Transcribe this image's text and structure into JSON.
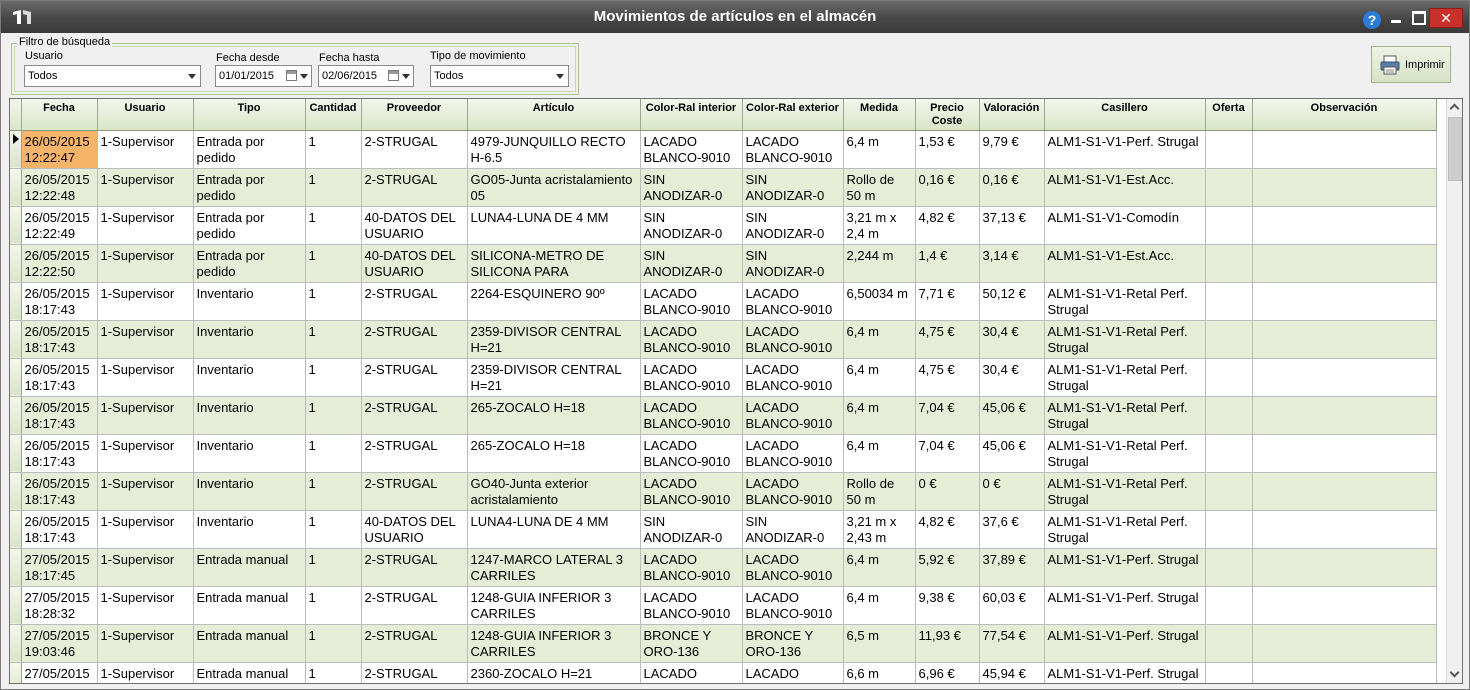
{
  "window": {
    "title": "Movimientos de artículos en el almacén",
    "help": "?",
    "close": "✕"
  },
  "filter": {
    "legend": "Filtro de búsqueda",
    "usuario": {
      "label": "Usuario",
      "value": "Todos"
    },
    "fecha_desde": {
      "label": "Fecha desde",
      "value": "01/01/2015"
    },
    "fecha_hasta": {
      "label": "Fecha hasta",
      "value": "02/06/2015"
    },
    "tipo": {
      "label": "Tipo de movimiento",
      "value": "Todos"
    }
  },
  "print_button": {
    "label": "Imprimir"
  },
  "columns": [
    "Fecha",
    "Usuario",
    "Tipo",
    "Cantidad",
    "Proveedor",
    "Artículo",
    "Color-Ral interior",
    "Color-Ral exterior",
    "Medida",
    "Precio Coste",
    "Valoración",
    "Casillero",
    "Oferta",
    "Observación"
  ],
  "rows": [
    [
      "26/05/2015 12:22:47",
      "1-Supervisor",
      "Entrada por pedido",
      "1",
      "2-STRUGAL",
      "4979-JUNQUILLO RECTO H-6.5",
      "LACADO BLANCO-9010",
      "LACADO BLANCO-9010",
      "6,4 m",
      "1,53 €",
      "9,79 €",
      "ALM1-S1-V1-Perf. Strugal",
      "",
      ""
    ],
    [
      "26/05/2015 12:22:48",
      "1-Supervisor",
      "Entrada por pedido",
      "1",
      "2-STRUGAL",
      "GO05-Junta acristalamiento 05",
      "SIN ANODIZAR-0",
      "SIN ANODIZAR-0",
      "Rollo de 50 m",
      "0,16 €",
      "0,16 €",
      "ALM1-S1-V1-Est.Acc.",
      "",
      ""
    ],
    [
      "26/05/2015 12:22:49",
      "1-Supervisor",
      "Entrada por pedido",
      "1",
      "40-DATOS DEL USUARIO",
      "LUNA4-LUNA DE 4 MM",
      "SIN ANODIZAR-0",
      "SIN ANODIZAR-0",
      "3,21 m x 2,4 m",
      "4,82 €",
      "37,13 €",
      "ALM1-S1-V1-Comodín",
      "",
      ""
    ],
    [
      "26/05/2015 12:22:50",
      "1-Supervisor",
      "Entrada por pedido",
      "1",
      "40-DATOS DEL USUARIO",
      "SILICONA-METRO DE SILICONA PARA",
      "SIN ANODIZAR-0",
      "SIN ANODIZAR-0",
      "2,244 m",
      "1,4 €",
      "3,14 €",
      "ALM1-S1-V1-Est.Acc.",
      "",
      ""
    ],
    [
      "26/05/2015 18:17:43",
      "1-Supervisor",
      "Inventario",
      "1",
      "2-STRUGAL",
      "2264-ESQUINERO 90º",
      "LACADO BLANCO-9010",
      "LACADO BLANCO-9010",
      "6,50034 m",
      "7,71 €",
      "50,12 €",
      "ALM1-S1-V1-Retal Perf. Strugal",
      "",
      ""
    ],
    [
      "26/05/2015 18:17:43",
      "1-Supervisor",
      "Inventario",
      "1",
      "2-STRUGAL",
      "2359-DIVISOR CENTRAL H=21",
      "LACADO BLANCO-9010",
      "LACADO BLANCO-9010",
      "6,4 m",
      "4,75 €",
      "30,4 €",
      "ALM1-S1-V1-Retal Perf. Strugal",
      "",
      ""
    ],
    [
      "26/05/2015 18:17:43",
      "1-Supervisor",
      "Inventario",
      "1",
      "2-STRUGAL",
      "2359-DIVISOR CENTRAL H=21",
      "LACADO BLANCO-9010",
      "LACADO BLANCO-9010",
      "6,4 m",
      "4,75 €",
      "30,4 €",
      "ALM1-S1-V1-Retal Perf. Strugal",
      "",
      ""
    ],
    [
      "26/05/2015 18:17:43",
      "1-Supervisor",
      "Inventario",
      "1",
      "2-STRUGAL",
      "265-ZOCALO H=18",
      "LACADO BLANCO-9010",
      "LACADO BLANCO-9010",
      "6,4 m",
      "7,04 €",
      "45,06 €",
      "ALM1-S1-V1-Retal Perf. Strugal",
      "",
      ""
    ],
    [
      "26/05/2015 18:17:43",
      "1-Supervisor",
      "Inventario",
      "1",
      "2-STRUGAL",
      "265-ZOCALO H=18",
      "LACADO BLANCO-9010",
      "LACADO BLANCO-9010",
      "6,4 m",
      "7,04 €",
      "45,06 €",
      "ALM1-S1-V1-Retal Perf. Strugal",
      "",
      ""
    ],
    [
      "26/05/2015 18:17:43",
      "1-Supervisor",
      "Inventario",
      "1",
      "2-STRUGAL",
      "GO40-Junta exterior acristalamiento",
      "LACADO BLANCO-9010",
      "LACADO BLANCO-9010",
      "Rollo de 50 m",
      "0 €",
      "0 €",
      "ALM1-S1-V1-Retal Perf. Strugal",
      "",
      ""
    ],
    [
      "26/05/2015 18:17:43",
      "1-Supervisor",
      "Inventario",
      "1",
      "40-DATOS DEL USUARIO",
      "LUNA4-LUNA DE 4 MM",
      "SIN ANODIZAR-0",
      "SIN ANODIZAR-0",
      "3,21 m x 2,43 m",
      "4,82 €",
      "37,6 €",
      "ALM1-S1-V1-Retal Perf. Strugal",
      "",
      ""
    ],
    [
      "27/05/2015 18:17:45",
      "1-Supervisor",
      "Entrada manual",
      "1",
      "2-STRUGAL",
      "1247-MARCO LATERAL 3 CARRILES",
      "LACADO BLANCO-9010",
      "LACADO BLANCO-9010",
      "6,4 m",
      "5,92 €",
      "37,89 €",
      "ALM1-S1-V1-Perf. Strugal",
      "",
      ""
    ],
    [
      "27/05/2015 18:28:32",
      "1-Supervisor",
      "Entrada manual",
      "1",
      "2-STRUGAL",
      "1248-GUIA INFERIOR 3 CARRILES",
      "LACADO BLANCO-9010",
      "LACADO BLANCO-9010",
      "6,4 m",
      "9,38 €",
      "60,03 €",
      "ALM1-S1-V1-Perf. Strugal",
      "",
      ""
    ],
    [
      "27/05/2015 19:03:46",
      "1-Supervisor",
      "Entrada manual",
      "1",
      "2-STRUGAL",
      "1248-GUIA INFERIOR 3 CARRILES",
      "BRONCE Y ORO-136",
      "BRONCE Y ORO-136",
      "6,5 m",
      "11,93 €",
      "77,54 €",
      "ALM1-S1-V1-Perf. Strugal",
      "",
      ""
    ],
    [
      "27/05/2015",
      "1-Supervisor",
      "Entrada manual",
      "1",
      "2-STRUGAL",
      "2360-ZOCALO H=21",
      "LACADO",
      "LACADO",
      "6,6 m",
      "6,96 €",
      "45,94 €",
      "ALM1-S1-V1-Perf. Strugal",
      "",
      ""
    ]
  ],
  "colors": {
    "alt_row": "#e6edd6",
    "selected_cell": "#f6b46b"
  }
}
